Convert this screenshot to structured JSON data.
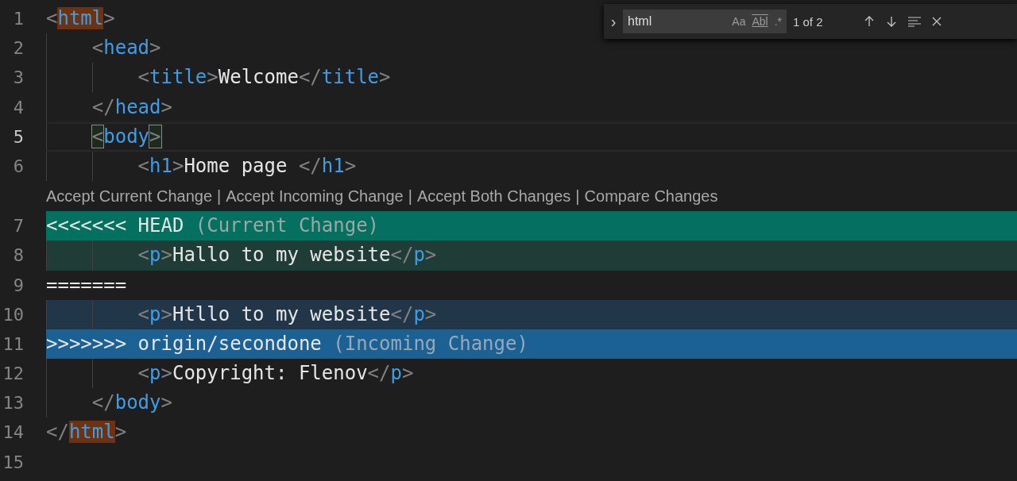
{
  "find_widget": {
    "toggle": "›",
    "query": "html",
    "options": [
      {
        "label": "Aa",
        "kind": "case",
        "selected": false
      },
      {
        "label": "Abl",
        "kind": "word",
        "selected": false
      },
      {
        "label": ".*",
        "kind": "regex",
        "selected": false
      }
    ],
    "count": "1 of 2"
  },
  "lines": [
    {
      "number": "1",
      "kind": "code",
      "selected": false,
      "tokens": [
        {
          "kind": "punct",
          "text": "<"
        },
        {
          "kind": "tag",
          "text": "html",
          "match": true
        },
        {
          "kind": "punct",
          "text": ">"
        }
      ]
    },
    {
      "number": "2",
      "kind": "code",
      "selected": false,
      "tokens": [
        {
          "kind": "punct",
          "text": "    <"
        },
        {
          "kind": "tag",
          "text": "head"
        },
        {
          "kind": "punct",
          "text": ">"
        }
      ]
    },
    {
      "number": "3",
      "kind": "code",
      "selected": false,
      "tokens": [
        {
          "kind": "punct",
          "text": "        <"
        },
        {
          "kind": "tag",
          "text": "title"
        },
        {
          "kind": "punct",
          "text": ">"
        },
        {
          "kind": "text",
          "text": "Welcome"
        },
        {
          "kind": "punct",
          "text": "</"
        },
        {
          "kind": "tag",
          "text": "title"
        },
        {
          "kind": "punct",
          "text": ">"
        }
      ]
    },
    {
      "number": "4",
      "kind": "code",
      "selected": false,
      "tokens": [
        {
          "kind": "punct",
          "text": "    </"
        },
        {
          "kind": "tag",
          "text": "head"
        },
        {
          "kind": "punct",
          "text": ">"
        }
      ]
    },
    {
      "number": "5",
      "kind": "code",
      "selected": true,
      "tokens": [
        {
          "kind": "punct",
          "text": "    <",
          "bracket": true
        },
        {
          "kind": "tag",
          "text": "body"
        },
        {
          "kind": "punct",
          "text": ">",
          "bracket": true
        }
      ]
    },
    {
      "number": "6",
      "kind": "code",
      "selected": false,
      "tokens": [
        {
          "kind": "punct",
          "text": "        <"
        },
        {
          "kind": "tag",
          "text": "h1"
        },
        {
          "kind": "punct",
          "text": ">"
        },
        {
          "kind": "text",
          "text": "Home page "
        },
        {
          "kind": "punct",
          "text": "</"
        },
        {
          "kind": "tag",
          "text": "h1"
        },
        {
          "kind": "punct",
          "text": ">"
        }
      ]
    },
    {
      "kind": "codelens",
      "actions": [
        "Accept Current Change",
        "Accept Incoming Change",
        "Accept Both Changes",
        "Compare Changes"
      ],
      "separator": "|"
    },
    {
      "number": "7",
      "kind": "current-header",
      "selected": false,
      "tokens": [
        {
          "kind": "text",
          "text": "<<<<<<< HEAD "
        },
        {
          "kind": "label",
          "text": "(Current Change)"
        }
      ]
    },
    {
      "number": "8",
      "kind": "current",
      "selected": false,
      "tokens": [
        {
          "kind": "punct",
          "text": "        <"
        },
        {
          "kind": "tag",
          "text": "p"
        },
        {
          "kind": "punct",
          "text": ">"
        },
        {
          "kind": "text",
          "text": "Hallo to my website"
        },
        {
          "kind": "punct",
          "text": "</"
        },
        {
          "kind": "tag",
          "text": "p"
        },
        {
          "kind": "punct",
          "text": ">"
        }
      ]
    },
    {
      "number": "9",
      "kind": "code",
      "selected": false,
      "tokens": [
        {
          "kind": "text",
          "text": "======="
        }
      ]
    },
    {
      "number": "10",
      "kind": "incoming",
      "selected": false,
      "tokens": [
        {
          "kind": "punct",
          "text": "        <"
        },
        {
          "kind": "tag",
          "text": "p"
        },
        {
          "kind": "punct",
          "text": ">"
        },
        {
          "kind": "text",
          "text": "Htllo to my website"
        },
        {
          "kind": "punct",
          "text": "</"
        },
        {
          "kind": "tag",
          "text": "p"
        },
        {
          "kind": "punct",
          "text": ">"
        }
      ]
    },
    {
      "number": "11",
      "kind": "incoming-header",
      "selected": false,
      "tokens": [
        {
          "kind": "text",
          "text": ">>>>>>> origin/secondone "
        },
        {
          "kind": "label",
          "text": "(Incoming Change)"
        }
      ]
    },
    {
      "number": "12",
      "kind": "code",
      "selected": false,
      "tokens": [
        {
          "kind": "punct",
          "text": "        <"
        },
        {
          "kind": "tag",
          "text": "p"
        },
        {
          "kind": "punct",
          "text": ">"
        },
        {
          "kind": "text",
          "text": "Copyright: Flenov"
        },
        {
          "kind": "punct",
          "text": "</"
        },
        {
          "kind": "tag",
          "text": "p"
        },
        {
          "kind": "punct",
          "text": ">"
        }
      ]
    },
    {
      "number": "13",
      "kind": "code",
      "selected": false,
      "tokens": [
        {
          "kind": "punct",
          "text": "    </"
        },
        {
          "kind": "tag",
          "text": "body"
        },
        {
          "kind": "punct",
          "text": ">"
        }
      ]
    },
    {
      "number": "14",
      "kind": "code",
      "selected": false,
      "tokens": [
        {
          "kind": "punct",
          "text": "</"
        },
        {
          "kind": "tag",
          "text": "html",
          "match": true
        },
        {
          "kind": "punct",
          "text": ">"
        }
      ]
    },
    {
      "number": "15",
      "kind": "code",
      "selected": false
    }
  ]
}
